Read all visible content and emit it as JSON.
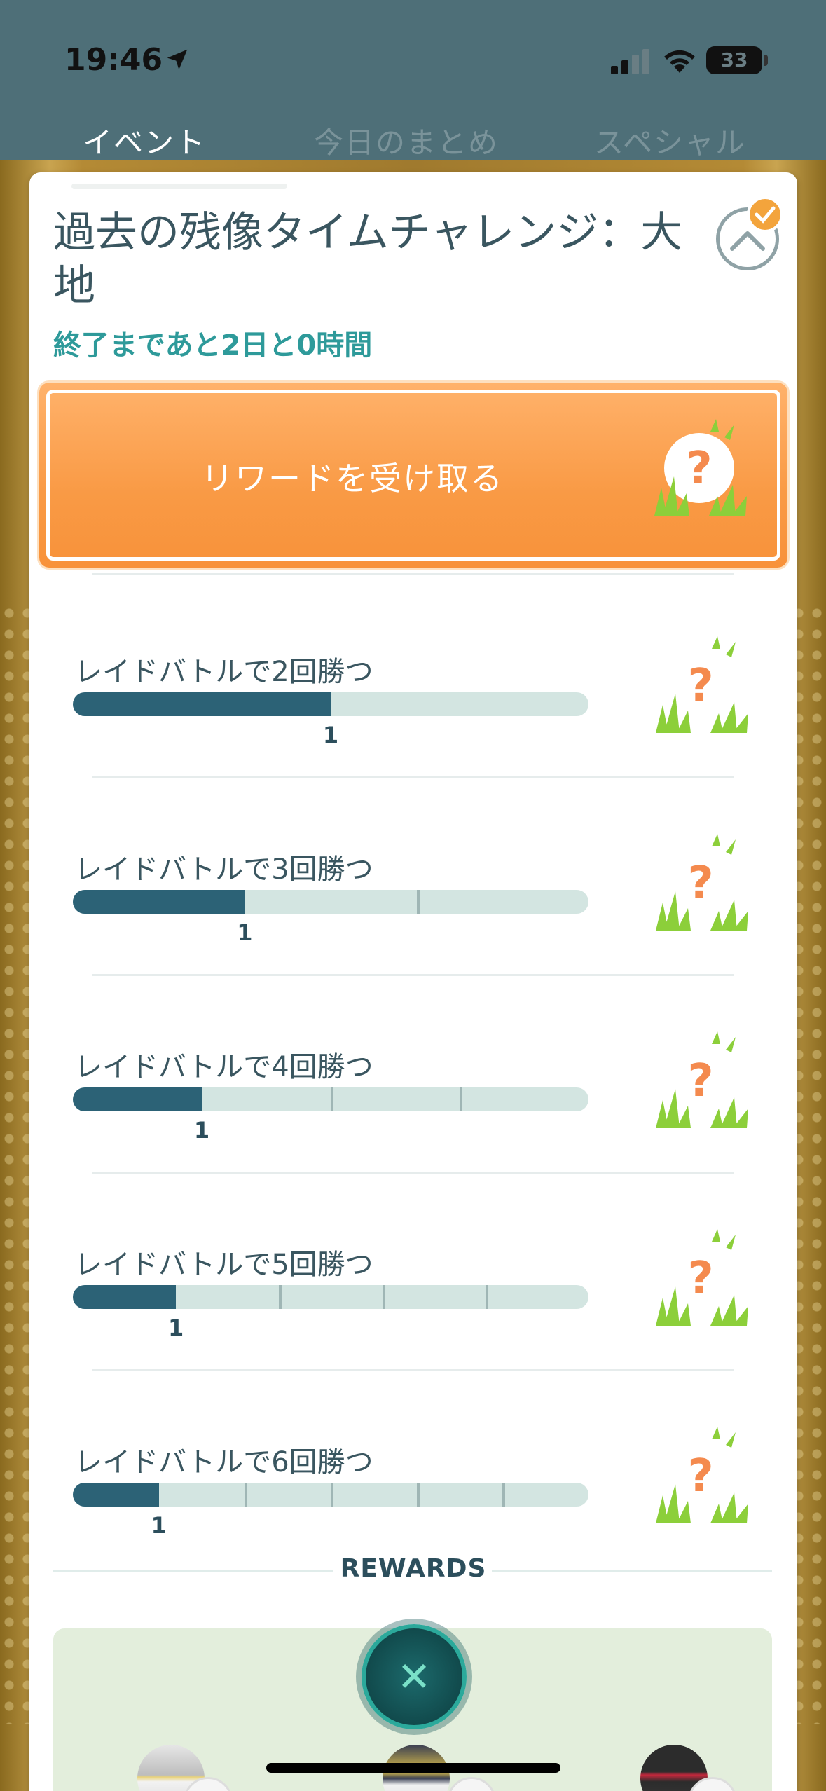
{
  "status_bar": {
    "time": "19:46",
    "battery": "33"
  },
  "tabs": [
    {
      "label": "イベント",
      "active": true
    },
    {
      "label": "今日のまとめ",
      "active": false
    },
    {
      "label": "スペシャル",
      "active": false
    }
  ],
  "card": {
    "title": "過去の残像タイムチャレンジ：大地",
    "subtitle": "終了まであと2日と0時間",
    "reward_button": "リワードを受け取る"
  },
  "tasks": [
    {
      "label": "レイドバトルで2回勝つ",
      "progress": 1,
      "goal": 2,
      "progress_label": "1"
    },
    {
      "label": "レイドバトルで3回勝つ",
      "progress": 1,
      "goal": 3,
      "progress_label": "1"
    },
    {
      "label": "レイドバトルで4回勝つ",
      "progress": 1,
      "goal": 4,
      "progress_label": "1"
    },
    {
      "label": "レイドバトルで5回勝つ",
      "progress": 1,
      "goal": 5,
      "progress_label": "1"
    },
    {
      "label": "レイドバトルで6回勝つ",
      "progress": 1,
      "goal": 6,
      "progress_label": "1"
    }
  ],
  "rewards": {
    "title": "REWARDS",
    "close_icon": "close-icon"
  },
  "icons": {
    "mystery": "question-mark-in-grass-icon",
    "collapse": "chevron-up-icon",
    "check": "check-icon"
  },
  "colors": {
    "accent": "#f99a45",
    "progress_fill": "#2c6276",
    "progress_track": "#d3e5e1",
    "subtitle": "#2e9a9a"
  }
}
